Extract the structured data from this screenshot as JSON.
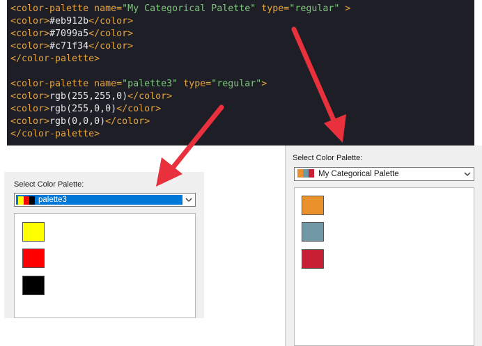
{
  "code": {
    "block1": {
      "open_tag": "<color-palette",
      "name_attr": "name=",
      "name_value": "\"My Categorical Palette\"",
      "type_attr": "type=",
      "type_value": "\"regular\"",
      "open_end": " >",
      "colors": [
        "#eb912b",
        "#7099a5",
        "#c71f34"
      ],
      "close_tag": "</color-palette>"
    },
    "block2": {
      "open_tag": "<color-palette",
      "name_attr": "name=",
      "name_value": "\"palette3\"",
      "type_attr": "type=",
      "type_value": "\"regular\"",
      "open_end": ">",
      "colors": [
        "rgb(255,255,0)",
        "rgb(255,0,0)",
        "rgb(0,0,0)"
      ],
      "close_tag": "</color-palette>"
    },
    "color_open": "<color>",
    "color_close": "</color>"
  },
  "left_panel": {
    "label": "Select Color Palette:",
    "selected_palette": "palette3",
    "swatch_colors": [
      "#ffff00",
      "#ff0000",
      "#000000"
    ]
  },
  "right_panel": {
    "label": "Select Color Palette:",
    "selected_palette": "My Categorical Palette",
    "swatch_colors": [
      "#eb912b",
      "#7099a5",
      "#c71f34"
    ]
  },
  "colors": {
    "arrow": "#e8313c",
    "selection": "#0078d7",
    "code_background": "#1e1f26"
  },
  "icons": [
    "chevron-down-icon",
    "arrow-icon"
  ]
}
